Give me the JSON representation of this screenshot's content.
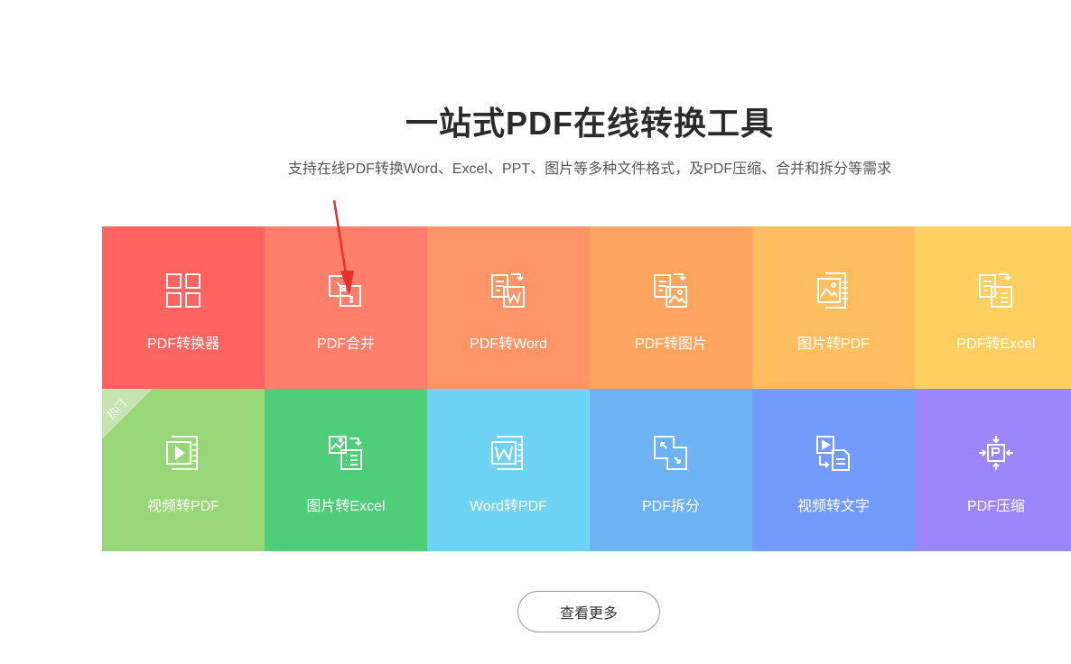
{
  "header": {
    "title": "一站式PDF在线转换工具",
    "subtitle": "支持在线PDF转换Word、Excel、PPT、图片等多种文件格式，及PDF压缩、合并和拆分等需求"
  },
  "hot_badge": "热门",
  "tools": [
    {
      "label": "PDF转换器",
      "color": "#ff6460",
      "icon": "grid-icon"
    },
    {
      "label": "PDF合并",
      "color": "#ff7f6a",
      "icon": "merge-icon"
    },
    {
      "label": "PDF转Word",
      "color": "#ff9468",
      "icon": "pdf-to-word-icon"
    },
    {
      "label": "PDF转图片",
      "color": "#ffa560",
      "icon": "pdf-to-image-icon"
    },
    {
      "label": "图片转PDF",
      "color": "#ffbe60",
      "icon": "image-to-pdf-icon"
    },
    {
      "label": "PDF转Excel",
      "color": "#ffcf5f",
      "icon": "pdf-to-excel-icon"
    },
    {
      "label": "视频转PDF",
      "color": "#98d777",
      "icon": "video-to-pdf-icon"
    },
    {
      "label": "图片转Excel",
      "color": "#4fcd79",
      "icon": "image-to-excel-icon"
    },
    {
      "label": "Word转PDF",
      "color": "#6dd2f4",
      "icon": "word-to-pdf-icon"
    },
    {
      "label": "PDF拆分",
      "color": "#6db3f4",
      "icon": "split-icon"
    },
    {
      "label": "视频转文字",
      "color": "#729bfc",
      "icon": "video-to-text-icon"
    },
    {
      "label": "PDF压缩",
      "color": "#9d86fc",
      "icon": "compress-icon"
    }
  ],
  "more_button": "查看更多",
  "annotation_color": "#e8312f"
}
